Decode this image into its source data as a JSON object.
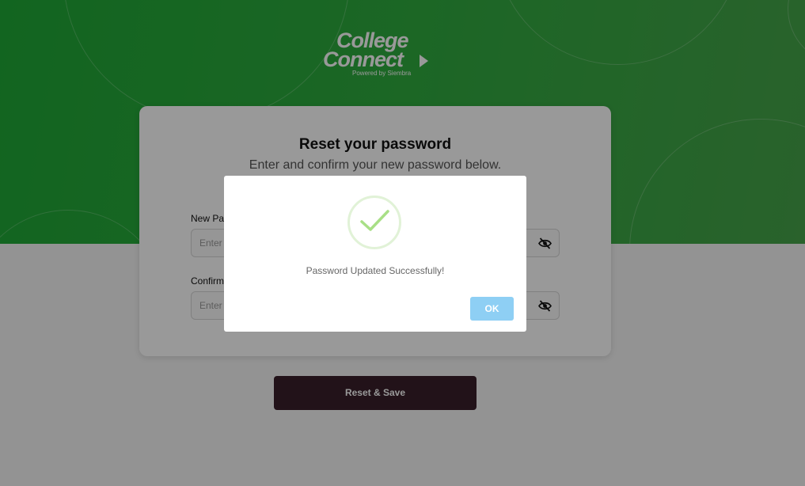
{
  "logo": {
    "line1": "College",
    "line2": "Connect",
    "tagline": "Powered by Siembra"
  },
  "card": {
    "title": "Reset your password",
    "subtitle": "Enter and confirm your new password below.",
    "fields": [
      {
        "label": "New Password",
        "placeholder": "Enter new password",
        "icon": "eye-slash-icon"
      },
      {
        "label": "Confirm Password",
        "placeholder": "Enter new password again",
        "icon": "eye-slash-icon"
      }
    ]
  },
  "reset_button": {
    "label": "Reset & Save"
  },
  "modal": {
    "icon": "checkmark-icon",
    "message": "Password Updated Successfully!",
    "ok_label": "OK"
  },
  "colors": {
    "hero_green": "#2fac3f",
    "reset_button": "#3a1f2a",
    "ok_button": "#8ecff4",
    "check": "#a8df86"
  }
}
